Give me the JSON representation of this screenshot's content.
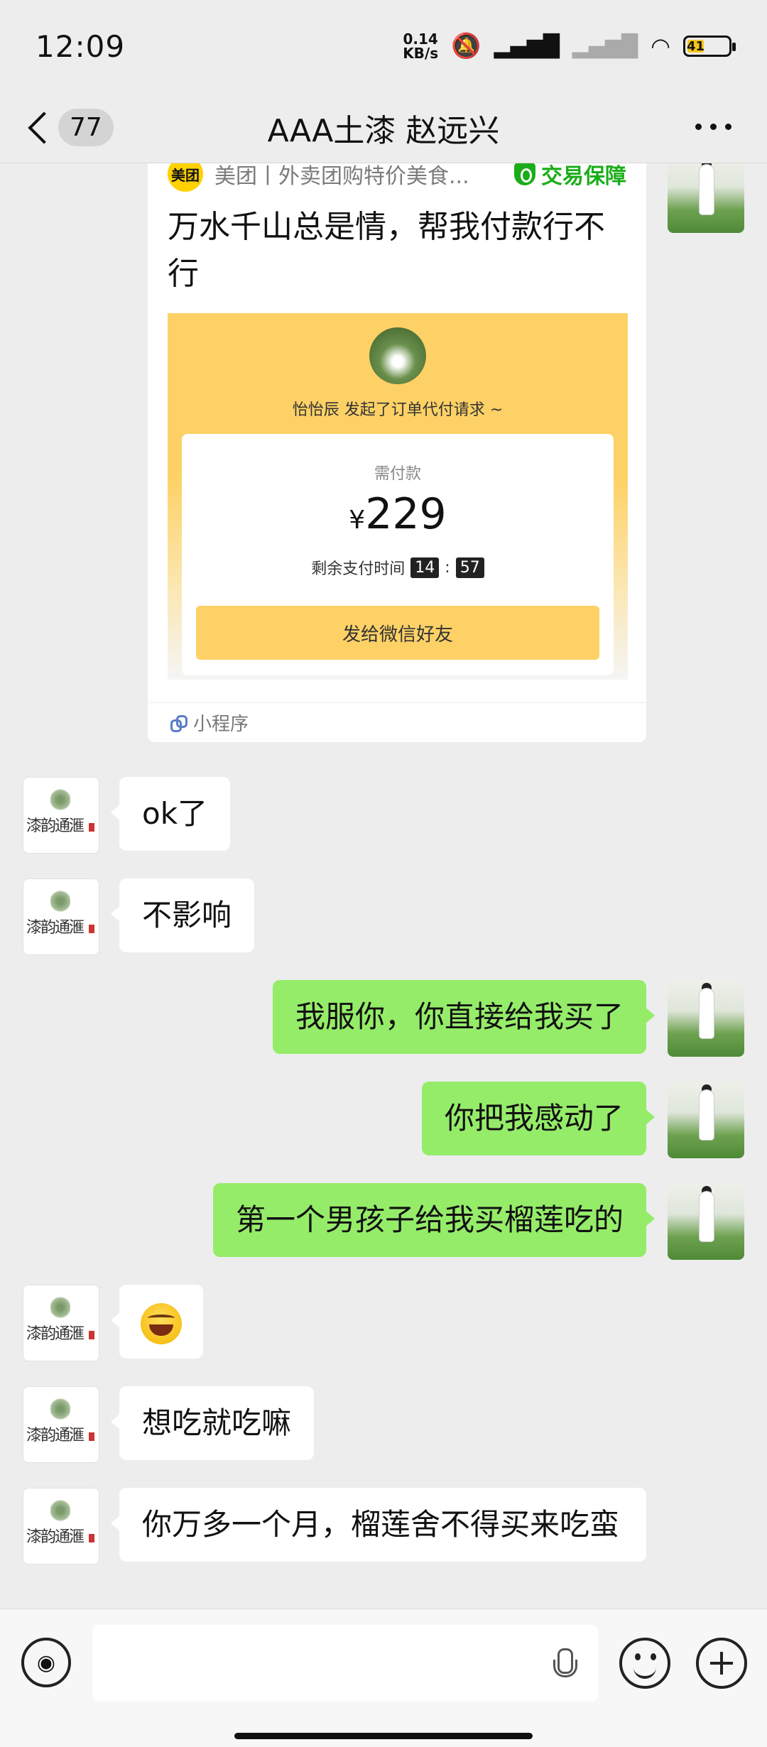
{
  "status_bar": {
    "time": "12:09",
    "net_speed_value": "0.14",
    "net_speed_unit": "KB/s",
    "battery": "41"
  },
  "header": {
    "unread_count": "77",
    "title": "AAA土漆  赵远兴"
  },
  "mini_program_card": {
    "source": "美团丨外卖团购特价美食...",
    "logo_text": "美团",
    "guarantee": "交易保障",
    "description": "万水千山总是情，帮我付款行不行",
    "requester_line": "怡怡辰 发起了订单代付请求 ~",
    "pay_label": "需付款",
    "currency": "¥",
    "amount": "229",
    "time_label": "剩余支付时间",
    "time_min": "14",
    "time_sep": ":",
    "time_sec": "57",
    "button": "发给微信好友",
    "footer": "小程序"
  },
  "messages": [
    {
      "side": "left",
      "text": "ok了"
    },
    {
      "side": "left",
      "text": "不影响"
    },
    {
      "side": "right",
      "text": "我服你，你直接给我买了"
    },
    {
      "side": "right",
      "text": "你把我感动了"
    },
    {
      "side": "right",
      "text": "第一个男孩子给我买榴莲吃的"
    },
    {
      "side": "left",
      "text": "",
      "emoji": "laughing-tears"
    },
    {
      "side": "left",
      "text": "想吃就吃嘛"
    },
    {
      "side": "left",
      "text": "你万多一个月，榴莲舍不得买来吃蛮"
    }
  ],
  "other_avatar_text": "漆韵通滙",
  "input_bar": {
    "placeholder": ""
  }
}
